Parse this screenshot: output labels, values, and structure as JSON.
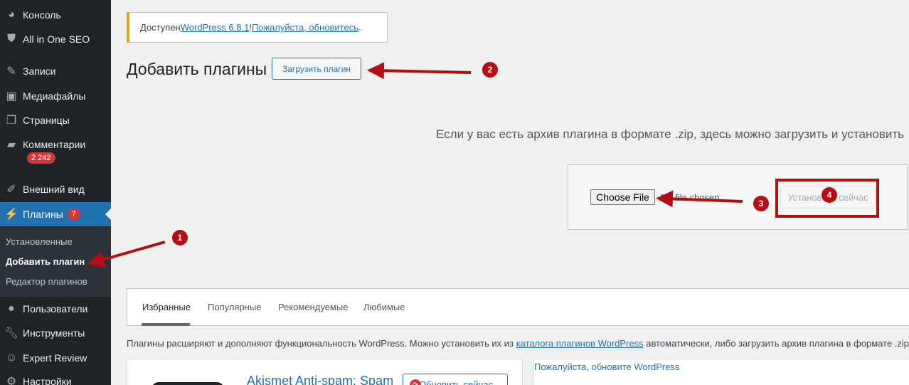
{
  "sidebar": {
    "items": [
      {
        "label": "Консоль",
        "icon": "dashboard-icon"
      },
      {
        "label": "All in One SEO",
        "icon": "shield-icon"
      },
      {
        "label": "Записи",
        "icon": "pin-icon"
      },
      {
        "label": "Медиафайлы",
        "icon": "media-icon"
      },
      {
        "label": "Страницы",
        "icon": "pages-icon"
      },
      {
        "label": "Комментарии",
        "icon": "comment-icon",
        "badge": "2 242"
      },
      {
        "label": "Внешний вид",
        "icon": "brush-icon"
      },
      {
        "label": "Плагины",
        "icon": "plugin-icon",
        "badge": "7"
      },
      {
        "label": "Пользователи",
        "icon": "user-icon"
      },
      {
        "label": "Инструменты",
        "icon": "wrench-icon"
      },
      {
        "label": "Expert Review",
        "icon": "review-icon"
      },
      {
        "label": "Настройки",
        "icon": "settings-icon"
      }
    ],
    "submenu": [
      "Установленные",
      "Добавить плагин",
      "Редактор плагинов"
    ]
  },
  "notice": {
    "prefix": "Доступен ",
    "version_link": "WordPress 6.8.1",
    "middle": "! ",
    "update_link": "Пожалуйста, обновитесь",
    "suffix": "."
  },
  "page": {
    "title": "Добавить плагины",
    "upload_button": "Загрузить плагин",
    "upload_description": "Если у вас есть архив плагина в формате .zip, здесь можно загрузить и установить",
    "choose_file": "Choose File",
    "no_file": "No file chosen",
    "install_button": "Установить сейчас"
  },
  "tabs": [
    "Избранные",
    "Популярные",
    "Рекомендуемые",
    "Любимые"
  ],
  "plugins_text": {
    "before": "Плагины расширяют и дополняют функциональность WordPress. Можно установить их из ",
    "link": "каталога плагинов WordPress",
    "after": " автоматически, либо загрузить архив плагина в формате .zip, на"
  },
  "plugin_card": {
    "name": "Akismet Anti-spam: Spam",
    "update_button": "Обновить сейчас"
  },
  "side_card": {
    "link": "Пожалуйста, обновите WordPress"
  },
  "annotations": [
    "1",
    "2",
    "3",
    "4"
  ],
  "colors": {
    "sidebar_bg": "#1d2327",
    "accent": "#2271b1",
    "annotation_red": "#b50e12",
    "notice_border": "#dba617"
  }
}
